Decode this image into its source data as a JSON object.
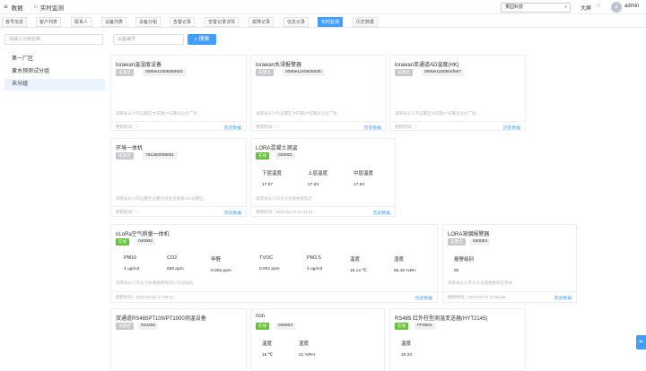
{
  "topbar": {
    "menu_icon": "≡",
    "title": "数据",
    "home_icon": "⌂",
    "page": "实时监测",
    "company": "果园科技",
    "screen": "大屏",
    "user_initial": "a",
    "user": "admin"
  },
  "tabs": [
    "各号信息",
    "客户列表",
    "联系人",
    "设备列表",
    "设备分组",
    "告警记录",
    "告警记录详情",
    "故障记录",
    "信息记录",
    "实时监测",
    "历史数据"
  ],
  "active_tab": 9,
  "sidebar": {
    "search_placeholder": "请输入分组名称",
    "items": [
      "第一厂区",
      "黄水预测试分组",
      "未分组"
    ],
    "selected": 2
  },
  "toolbar": {
    "device_placeholder": "设备编号",
    "search_label": "搜索"
  },
  "cards": [
    {
      "name": "lorawan温湿度设备",
      "status": "未激活",
      "code": "0080e1150505050c",
      "addr": "湖南省长沙市岳麓区文轩路27号麓谷企业广场...",
      "updated": "更新时间：--",
      "history": "历史数据"
    },
    {
      "name": "lorawan水浸报警器",
      "status": "未激活",
      "code": "0080e115050502fc",
      "addr": "湖南省长沙市岳麓区文轩路27号麓谷企业广场...",
      "updated": "更新时间：--",
      "history": "历史数据"
    },
    {
      "name": "lorawan单通道AD温度(HK)",
      "status": "未激活",
      "code": "0080e1150504fe67",
      "addr": "湖南省长沙市岳麓区文轩路27号麓谷企业广场...",
      "updated": "更新时间：--",
      "history": "历史数据"
    },
    {
      "name": "环境一体机",
      "status": "未激活",
      "code": "751260008001",
      "addr": "湖南省长沙市岳麓区岳麓街道金星南路403号麓园...",
      "updated": "更新时间：--",
      "history": "历史数据"
    },
    {
      "name": "LORA混凝土测温",
      "status": "在线",
      "code": "033001",
      "addr": "湖南省长沙市长沙县湘楼路附近",
      "updated": "更新时间：2023-02-27 11:11:21",
      "history": "历史数据",
      "metrics": [
        {
          "label": "下层温度",
          "value": "17.87"
        },
        {
          "label": "上层温度",
          "value": "17.93"
        },
        {
          "label": "中层温度",
          "value": "17.93"
        }
      ]
    },
    {
      "name": "nLoRa空气质量一体机",
      "status": "在线",
      "code": "040002",
      "addr": "湖南省长沙市长沙县湘楼路附近57号加油站",
      "updated": "更新时间：2023-03-24 17:28:21",
      "history": "历史数据",
      "metrics": [
        {
          "label": "PM10",
          "value": "4 ug/m3"
        },
        {
          "label": "CO2",
          "value": "658 ppm"
        },
        {
          "label": "甲醛",
          "value": "0.005 ppm"
        },
        {
          "label": "TVOC",
          "value": "0.002 ppm"
        },
        {
          "label": "PM2.5",
          "value": "4 ug/m3"
        },
        {
          "label": "温度",
          "value": "18.12 ℃"
        },
        {
          "label": "湿度",
          "value": "56.45 %RH"
        }
      ]
    },
    {
      "name": "LORA液烟报警器",
      "status": "未激活",
      "code": "040003",
      "addr": "湖南省长沙市长沙县湘楼路附近液体",
      "updated": "更新时间：2023-02-17 13:56:55",
      "history": "历史数据",
      "metrics": [
        {
          "label": "报警级别",
          "value": "50"
        }
      ]
    },
    {
      "name": "双通道RS485PT100/PT1000测温设备",
      "status": "未激活",
      "code": "010266"
    },
    {
      "name": "non",
      "status": "在线",
      "code": "040004",
      "metrics": [
        {
          "label": "温度",
          "value": "16 ℃"
        },
        {
          "label": "湿度",
          "value": "21 %RH"
        }
      ]
    },
    {
      "name": "RS485 红外柱型测温变送器(HYT2145)",
      "status": "在线",
      "code": "FF0001",
      "metrics": [
        {
          "label": "温度",
          "value": "16.33"
        }
      ]
    }
  ]
}
